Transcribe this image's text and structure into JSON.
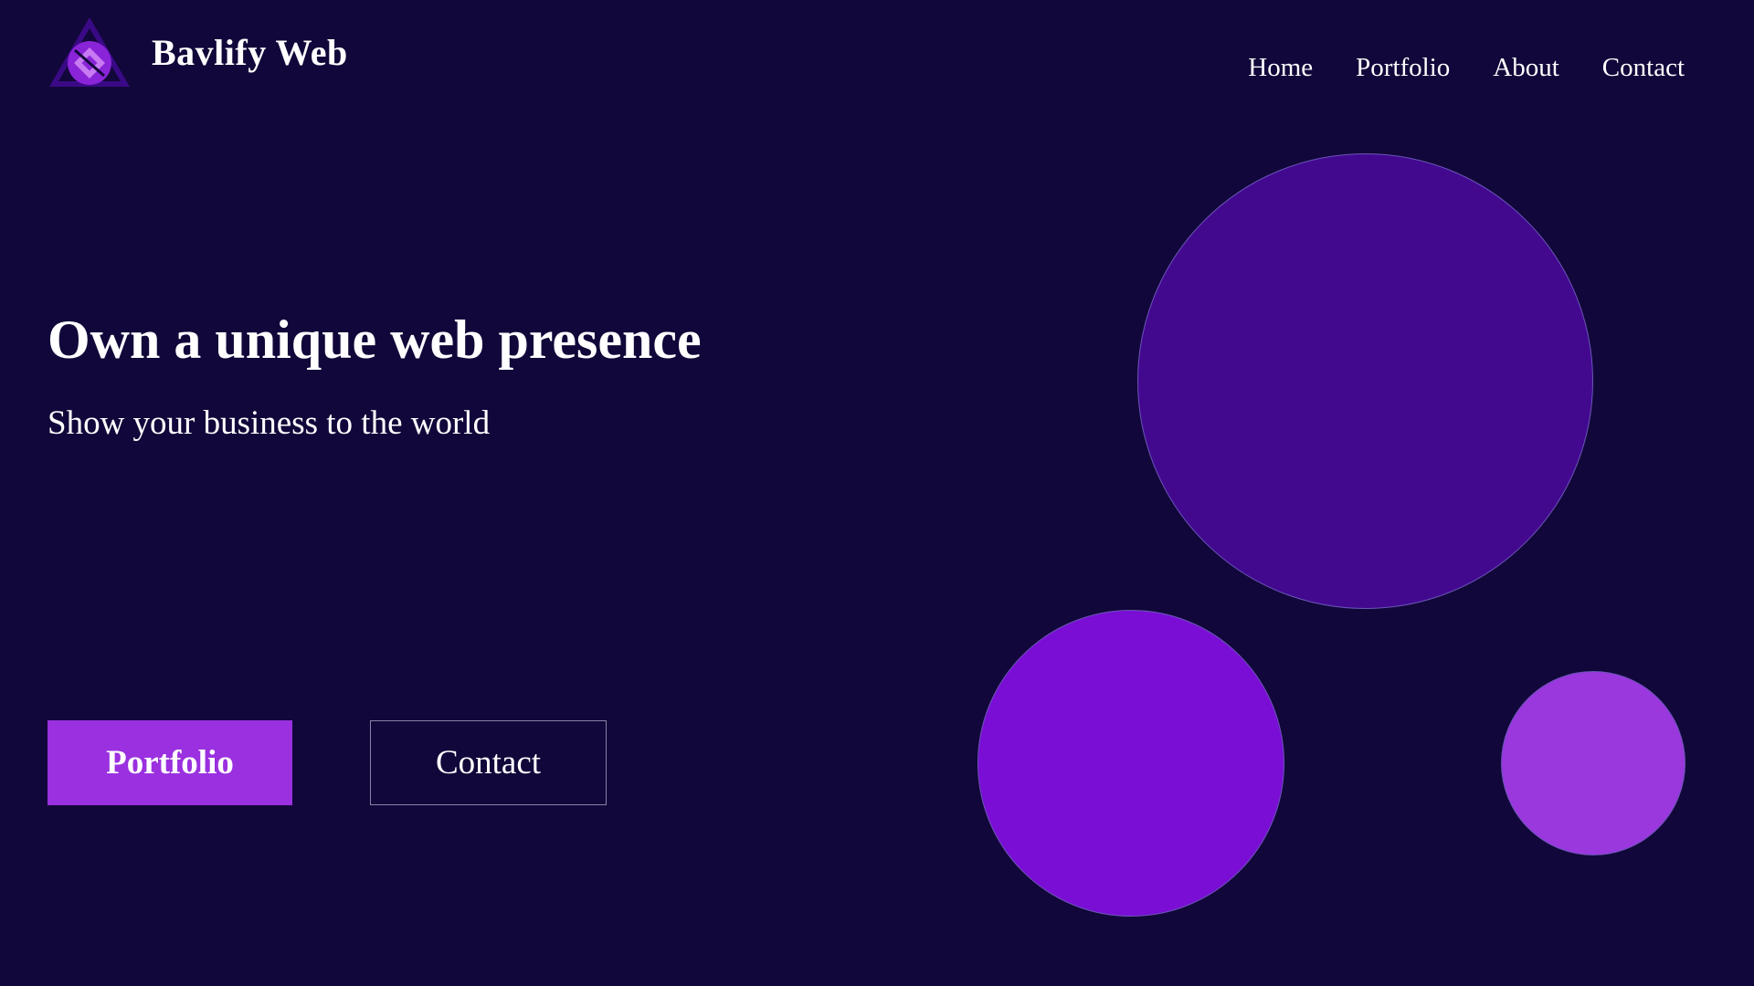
{
  "header": {
    "brand_name": "Bavlify Web",
    "logo_icon": "triangle-circle-diamond-logo"
  },
  "nav": {
    "items": [
      {
        "label": "Home"
      },
      {
        "label": "Portfolio"
      },
      {
        "label": "About"
      },
      {
        "label": "Contact"
      }
    ]
  },
  "hero": {
    "title": "Own a unique web presence",
    "subtitle": "Show your business to the world"
  },
  "buttons": {
    "primary_label": "Portfolio",
    "secondary_label": "Contact"
  },
  "colors": {
    "background": "#12073a",
    "accent": "#9a30df",
    "circle_large": "#42098f",
    "circle_medium": "#7a0ed4",
    "circle_small": "#9a37dd"
  }
}
